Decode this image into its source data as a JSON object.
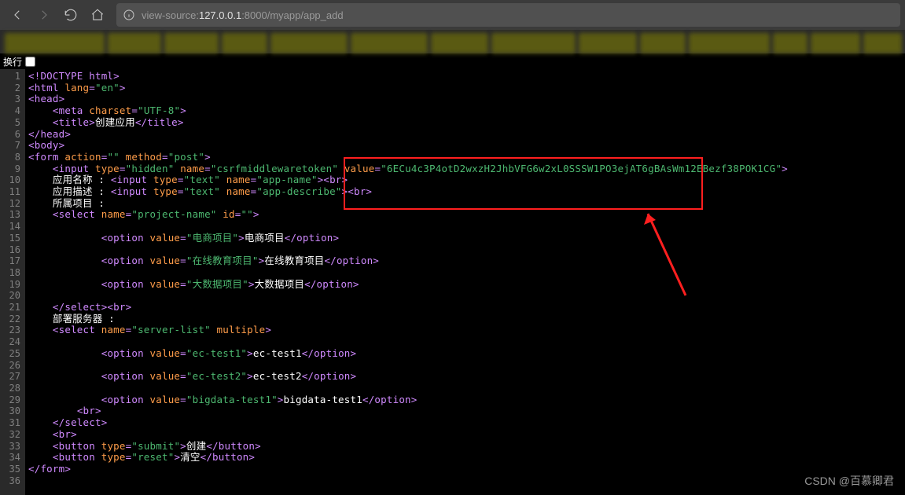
{
  "toolbar": {
    "url_prefix": "view-source:",
    "url_host": "127.0.0.1",
    "url_port_path": ":8000/myapp/app_add"
  },
  "wrapRow": {
    "label": "换行"
  },
  "lineCount": 36,
  "code": {
    "l1": {
      "t1": "<!DOCTYPE html>"
    },
    "l2": {
      "t1": "<html ",
      "a1": "lang",
      "v1": "\"en\"",
      "t2": ">"
    },
    "l3": {
      "t1": "<head>"
    },
    "l4": {
      "t1": "<meta ",
      "a1": "charset",
      "v1": "\"UTF-8\"",
      "t2": ">"
    },
    "l5": {
      "t1": "<title>",
      "txt": "创建应用",
      "t2": "</title>"
    },
    "l6": {
      "t1": "</head>"
    },
    "l7": {
      "t1": "<body>"
    },
    "l8": {
      "t1": "<form ",
      "a1": "action",
      "v1": "\"\"",
      "a2": "method",
      "v2": "\"post\"",
      "t2": ">"
    },
    "l9": {
      "t1": "<input ",
      "a1": "type",
      "v1": "\"hidden\"",
      "a2": "name",
      "v2": "\"csrfmiddlewaretoken\"",
      "a3": "value",
      "v3": "\"6ECu4c3P4otD2wxzH2JhbVFG6w2xL0SSSW1PO3ejAT6gBAsWm12EBezf38POK1CG\"",
      "t2": ">"
    },
    "l10": {
      "txt": "应用名称 : ",
      "t1": "<input ",
      "a1": "type",
      "v1": "\"text\"",
      "a2": "name",
      "v2": "\"app-name\"",
      "t2": "><br>"
    },
    "l11": {
      "txt": "应用描述 : ",
      "t1": "<input ",
      "a1": "type",
      "v1": "\"text\"",
      "a2": "name",
      "v2": "\"app-describe\"",
      "t2": "><br>"
    },
    "l12": {
      "txt": "所属项目 :"
    },
    "l13": {
      "t1": "<select ",
      "a1": "name",
      "v1": "\"project-name\"",
      "a2": "id",
      "v2": "\"\"",
      "t2": ">"
    },
    "l15": {
      "t1": "<option ",
      "a1": "value",
      "v1": "\"电商项目\"",
      "t2": ">",
      "txt": "电商项目",
      "t3": "</option>"
    },
    "l17": {
      "t1": "<option ",
      "a1": "value",
      "v1": "\"在线教育项目\"",
      "t2": ">",
      "txt": "在线教育项目",
      "t3": "</option>"
    },
    "l19": {
      "t1": "<option ",
      "a1": "value",
      "v1": "\"大数据项目\"",
      "t2": ">",
      "txt": "大数据项目",
      "t3": "</option>"
    },
    "l21": {
      "t1": "</select><br>"
    },
    "l22": {
      "txt": "部署服务器 :"
    },
    "l23": {
      "t1": "<select ",
      "a1": "name",
      "v1": "\"server-list\"",
      "a2": "multiple",
      "t2": ">"
    },
    "l25": {
      "t1": "<option ",
      "a1": "value",
      "v1": "\"ec-test1\"",
      "t2": ">",
      "txt": "ec-test1",
      "t3": "</option>"
    },
    "l27": {
      "t1": "<option ",
      "a1": "value",
      "v1": "\"ec-test2\"",
      "t2": ">",
      "txt": "ec-test2",
      "t3": "</option>"
    },
    "l29": {
      "t1": "<option ",
      "a1": "value",
      "v1": "\"bigdata-test1\"",
      "t2": ">",
      "txt": "bigdata-test1",
      "t3": "</option>"
    },
    "l30": {
      "t1": "<br>"
    },
    "l31": {
      "t1": "</select>"
    },
    "l32": {
      "t1": "<br>"
    },
    "l33": {
      "t1": "<button ",
      "a1": "type",
      "v1": "\"submit\"",
      "t2": ">",
      "txt": "创建",
      "t3": "</button>"
    },
    "l34": {
      "t1": "<button ",
      "a1": "type",
      "v1": "\"reset\"",
      "t2": ">",
      "txt": "清空",
      "t3": "</button>"
    },
    "l36": {
      "t1": "</form>"
    }
  },
  "tabs": {
    "widths": [
      130,
      70,
      70,
      60,
      100,
      100,
      75,
      110,
      75,
      60,
      105,
      45,
      65,
      50
    ]
  },
  "watermark": "CSDN @百慕卿君"
}
